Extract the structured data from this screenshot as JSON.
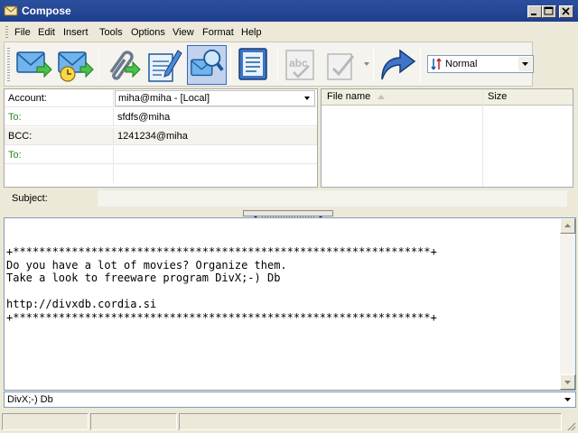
{
  "window": {
    "title": "Compose"
  },
  "menu": [
    "File",
    "Edit",
    "Insert",
    "Tools",
    "Options",
    "View",
    "Format",
    "Help"
  ],
  "toolbar": {
    "priority_value": "Normal",
    "icons": [
      "send-icon",
      "send-later-icon",
      "attach-icon",
      "edit-icon",
      "address-book-icon",
      "notes-icon",
      "spellcheck-icon",
      "sign-icon",
      "forward-icon"
    ]
  },
  "fields": {
    "account_label": "Account:",
    "account_value": "miha@miha - [Local]",
    "to_label": "To:",
    "to_value": "sfdfs@miha",
    "bcc_label": "BCC:",
    "bcc_value": "1241234@miha",
    "to2_label": "To:"
  },
  "attachments": {
    "col_name": "File name",
    "col_size": "Size"
  },
  "subject": {
    "label": "Subject:",
    "value": ""
  },
  "body": {
    "text": "+****************************************************************+\nDo you have a lot of movies? Organize them.\nTake a look to freeware program DivX;-) Db\n\nhttp://divxdb.cordia.si\n+****************************************************************+"
  },
  "signature": {
    "value": "DivX;-) Db"
  },
  "colors": {
    "titlebar": "#1f3f8e",
    "field_green": "#2a8a2a",
    "pressed": "#c1d2ee"
  }
}
